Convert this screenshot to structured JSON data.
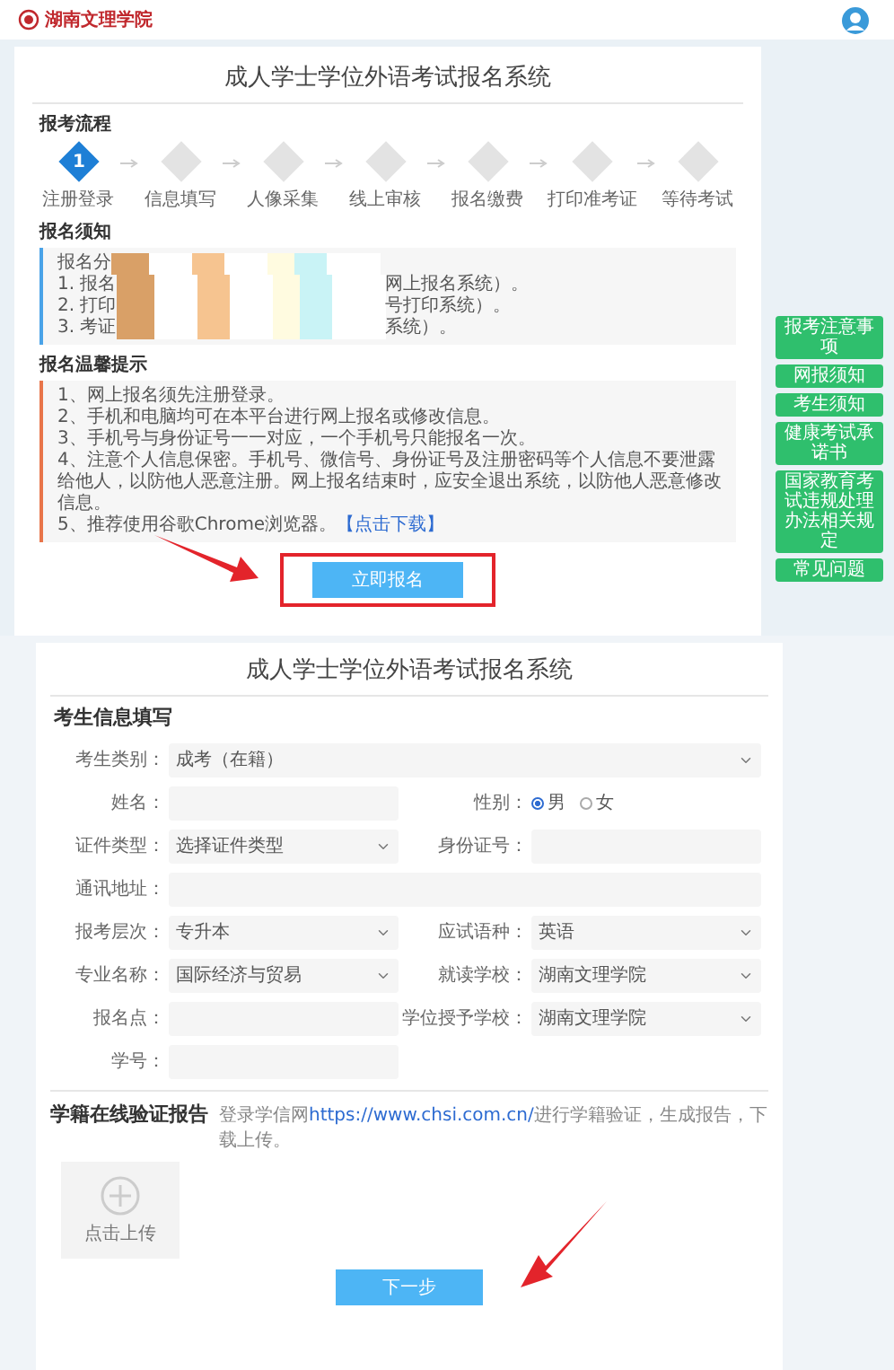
{
  "header": {
    "logo_text": "湖南文理学院"
  },
  "apply_page": {
    "title": "成人学士学位外语考试报名系统",
    "process": {
      "heading": "报考流程",
      "steps": [
        {
          "label": "注册登录",
          "selected": true,
          "number": "1"
        },
        {
          "label": "信息填写",
          "selected": false
        },
        {
          "label": "人像采集",
          "selected": false
        },
        {
          "label": "线上审核",
          "selected": false
        },
        {
          "label": "报名缴费",
          "selected": false
        },
        {
          "label": "打印准考证",
          "selected": false
        },
        {
          "label": "等待考试",
          "selected": false
        }
      ]
    },
    "notice": {
      "heading": "报名须知",
      "lines": [
        {
          "start": "报名分"
        },
        {
          "start": "1. 报名",
          "end": "网上报名系统）。"
        },
        {
          "start": "2. 打印",
          "end": "号打印系统）。"
        },
        {
          "start": "3. 考证",
          "end": "系统）。"
        }
      ]
    },
    "warnings": {
      "heading": "报名温馨提示",
      "items": [
        {
          "text": "1、网上报名须先注册登录。"
        },
        {
          "text": "2、手机和电脑均可在本平台进行网上报名或修改信息。"
        },
        {
          "text": "3、手机号与身份证号一一对应，一个手机号只能报名一次。"
        },
        {
          "text": "4、注意个人信息保密。手机号、微信号、身份证号及注册密码等个人信息不要泄露给他人，以防他人恶意注册。网上报名结束时，应安全退出系统，以防他人恶意修改信息。"
        },
        {
          "text": "5、推荐使用谷歌Chrome浏览器。",
          "link": "【点击下载】"
        }
      ]
    },
    "apply_button": "立即报名",
    "side_links": [
      "报考注意事项",
      "网报须知",
      "考生须知",
      "健康考试承诺书",
      "国家教育考试违规处理办法相关规定",
      "常见问题"
    ]
  },
  "form_page": {
    "title": "成人学士学位外语考试报名系统",
    "section": "考生信息填写",
    "rows": [
      [
        {
          "label": "考生类别：",
          "kind": "select",
          "value": "成考（在籍）",
          "wide": true
        }
      ],
      [
        {
          "label": "姓名：",
          "kind": "input"
        },
        {
          "label": "性别：",
          "kind": "radio",
          "options": [
            {
              "label": "男",
              "selected": true
            },
            {
              "label": "女",
              "selected": false
            }
          ]
        }
      ],
      [
        {
          "label": "证件类型：",
          "kind": "select",
          "value": "选择证件类型"
        },
        {
          "label": "身份证号：",
          "kind": "input"
        }
      ],
      [
        {
          "label": "通讯地址：",
          "kind": "input",
          "wide": true
        }
      ],
      [
        {
          "label": "报考层次：",
          "kind": "select",
          "value": "专升本"
        },
        {
          "label": "应试语种：",
          "kind": "select",
          "value": "英语"
        }
      ],
      [
        {
          "label": "专业名称：",
          "kind": "select",
          "value": "国际经济与贸易"
        },
        {
          "label": "就读学校：",
          "kind": "select",
          "value": "湖南文理学院"
        }
      ],
      [
        {
          "label": "报名点：",
          "kind": "input"
        },
        {
          "label": "学位授予学校：",
          "kind": "select",
          "value": "湖南文理学院"
        }
      ],
      [
        {
          "label": "学号：",
          "kind": "input"
        }
      ]
    ],
    "report": {
      "heading": "学籍在线验证报告",
      "hint_start": "登录学信网",
      "hint_link": "https://www.chsi.com.cn/",
      "hint_end": "进行学籍验证，生成报告，下载上传。",
      "upload": "点击上传"
    },
    "next_button": "下一步"
  }
}
